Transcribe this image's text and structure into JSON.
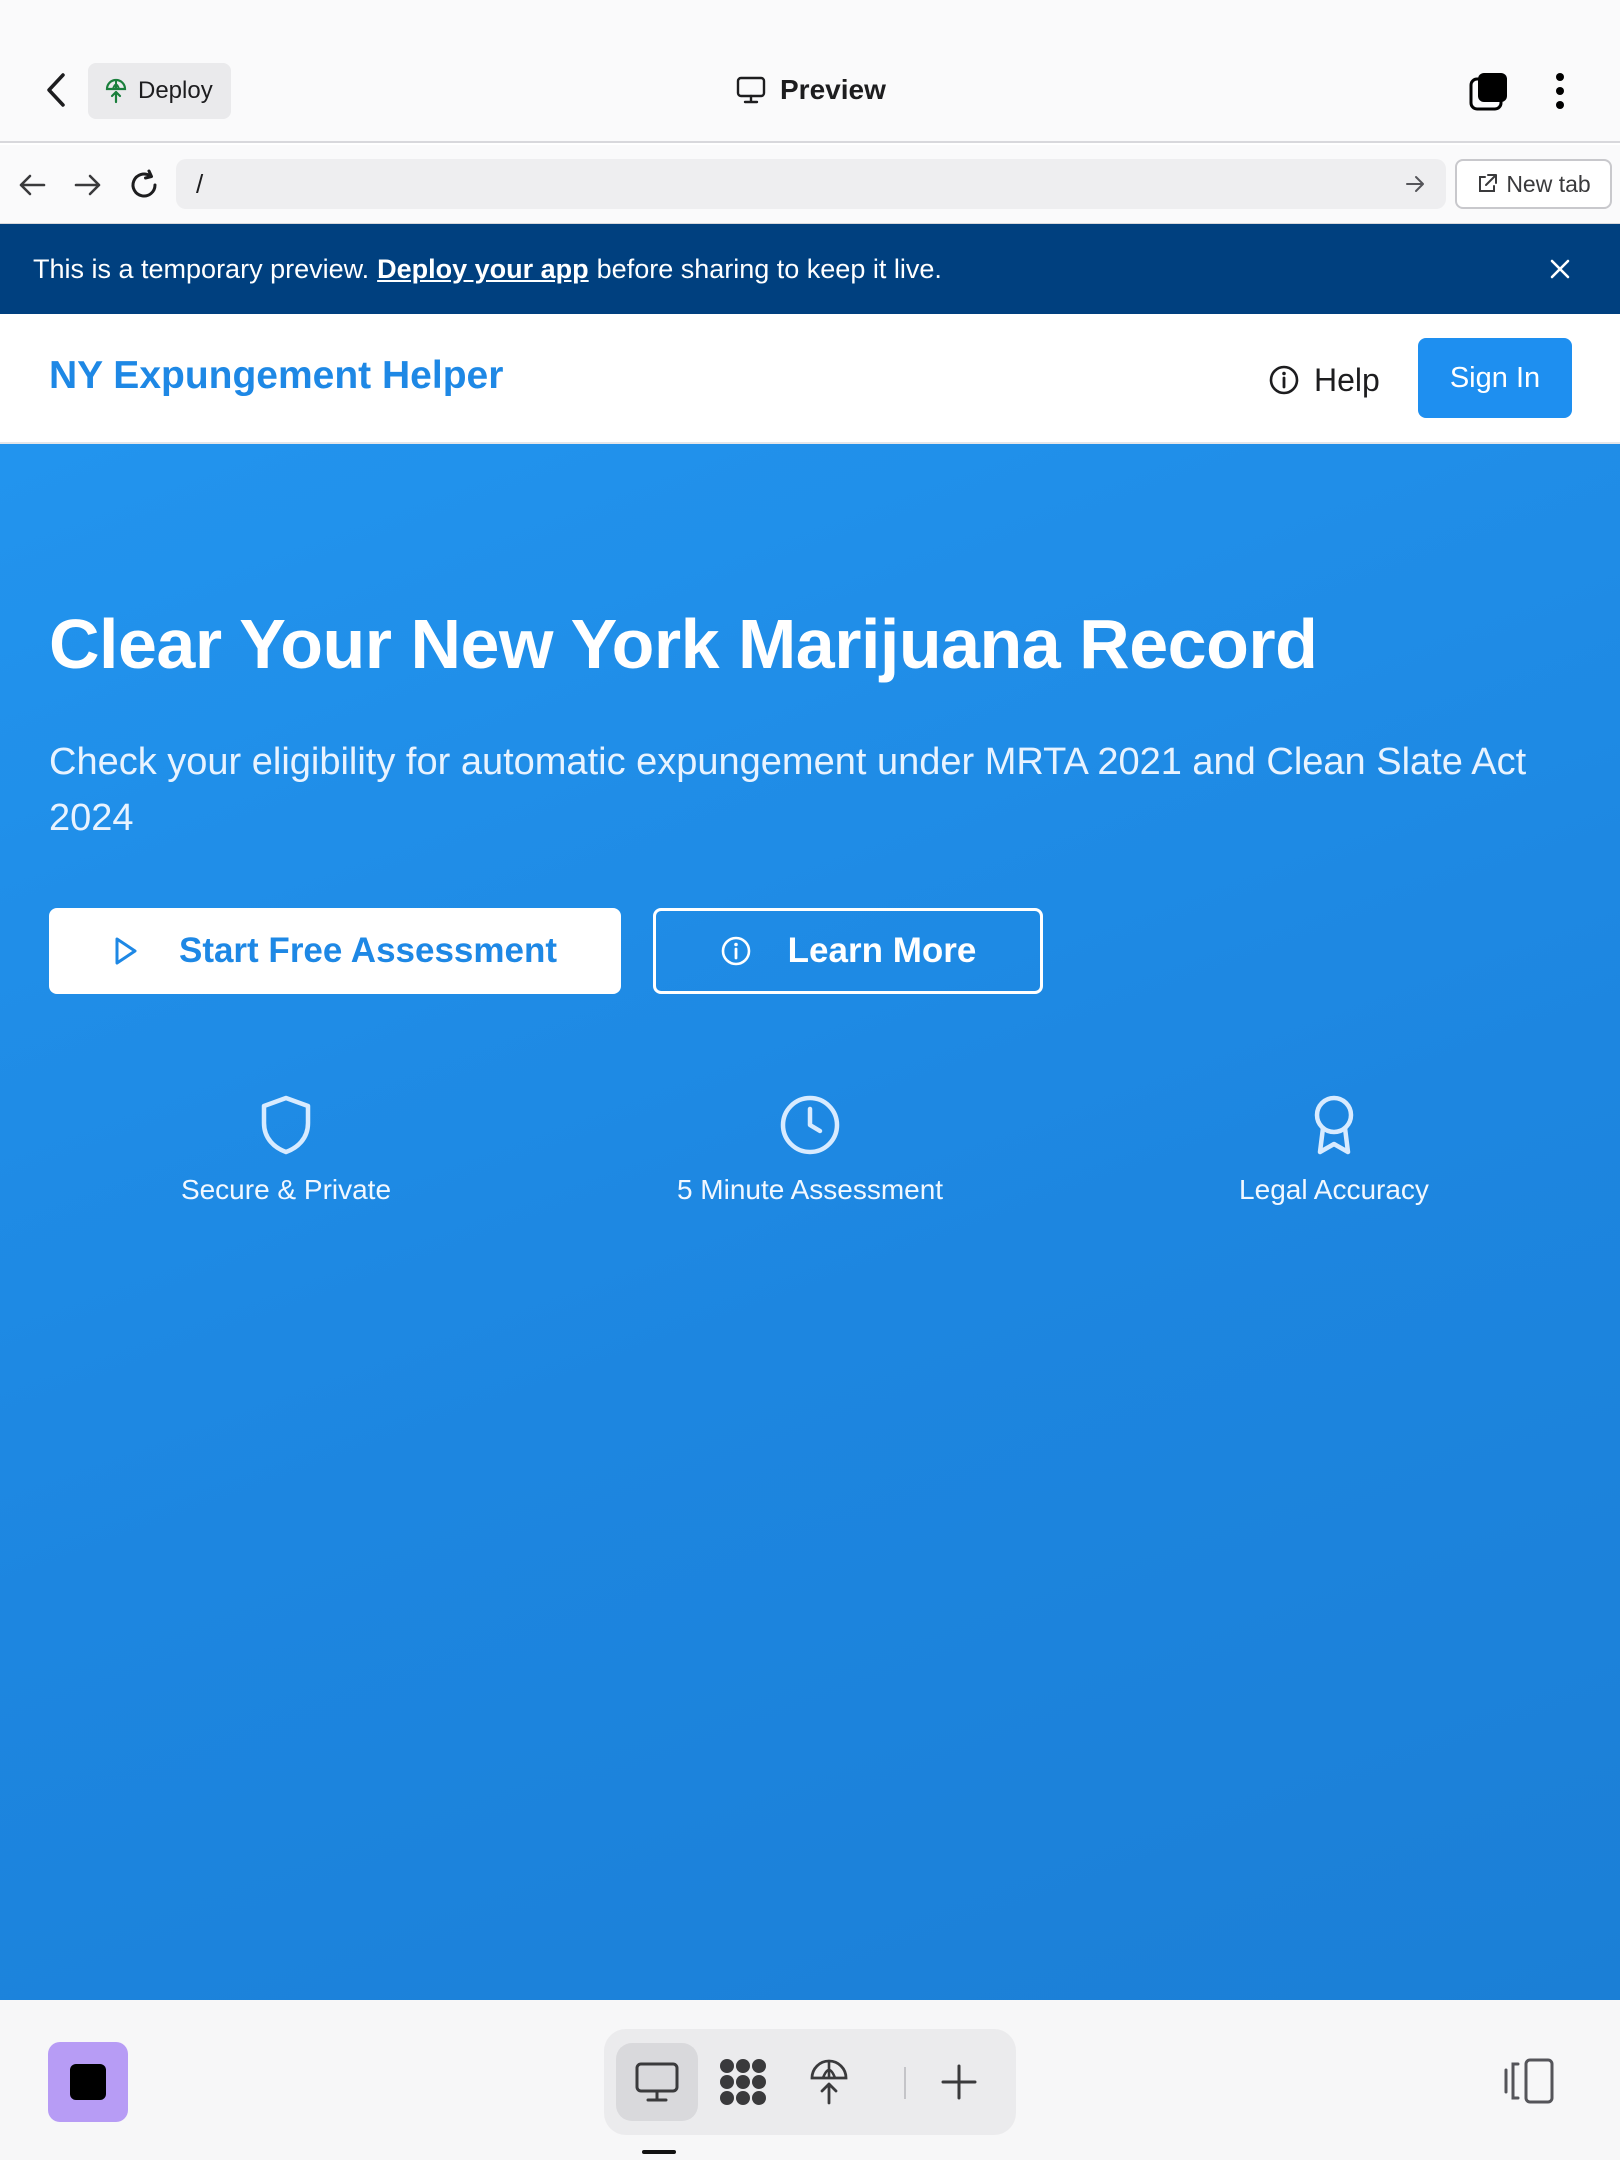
{
  "appbar": {
    "deploy_label": "Deploy",
    "title": "Preview"
  },
  "urlbar": {
    "url": "/",
    "new_tab_label": "New tab"
  },
  "banner": {
    "text_before": "This is a temporary preview.",
    "link_text": "Deploy your app",
    "text_after": "before sharing to keep it live."
  },
  "site": {
    "brand": "NY Expungement Helper",
    "help_label": "Help",
    "signin_label": "Sign In"
  },
  "hero": {
    "title": "Clear Your New York Marijuana Record",
    "subtitle": "Check your eligibility for automatic expungement under MRTA 2021 and Clean Slate Act 2024",
    "primary_cta": "Start Free Assessment",
    "secondary_cta": "Learn More",
    "features": [
      {
        "icon": "shield-icon",
        "label": "Secure & Private"
      },
      {
        "icon": "clock-icon",
        "label": "5 Minute Assessment"
      },
      {
        "icon": "award-icon",
        "label": "Legal Accuracy"
      }
    ]
  },
  "colors": {
    "brand_blue": "#1e88e5",
    "banner_navy": "#00407f",
    "stop_purple": "#b79cf5"
  }
}
